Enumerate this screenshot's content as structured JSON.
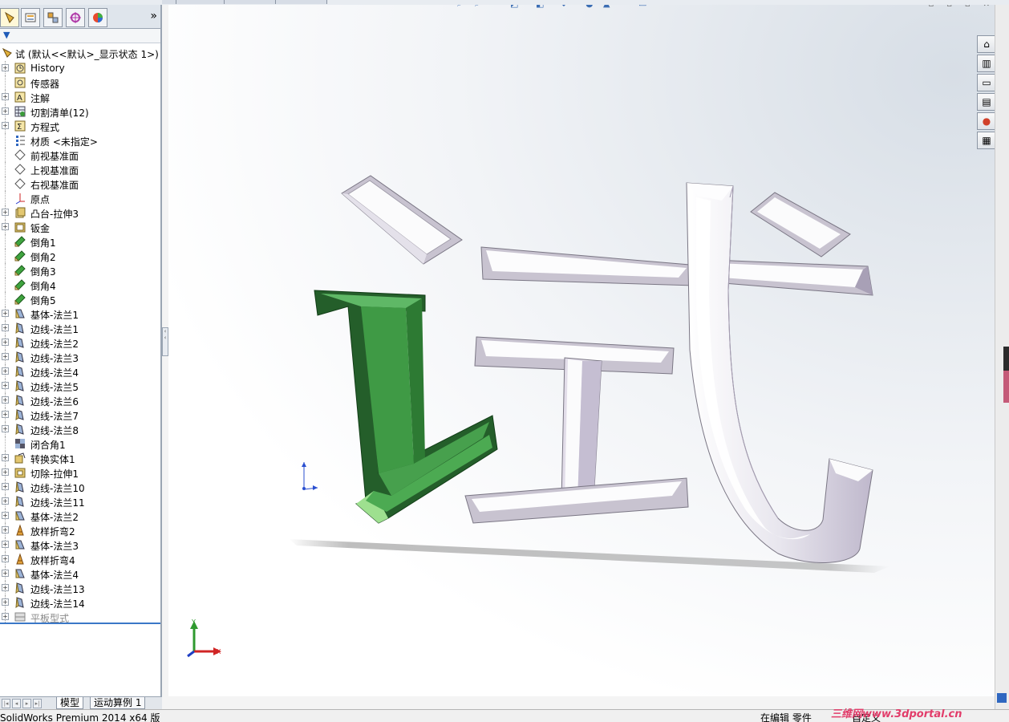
{
  "app": {
    "status_text": "SolidWorks Premium 2014 x64 版",
    "status_editing": "在编辑 零件",
    "status_custom": "自定义",
    "watermark": "三维网www.3dportal.cn"
  },
  "panel": {
    "expand_glyph": "»",
    "root_label": "试 (默认<<默认>_显示状态 1>)",
    "tree": [
      {
        "label": "History",
        "icon": "history-icon",
        "expand": true
      },
      {
        "label": "传感器",
        "icon": "sensor-icon",
        "expand": false
      },
      {
        "label": "注解",
        "icon": "annotation-icon",
        "expand": true
      },
      {
        "label": "切割清单(12)",
        "icon": "cutlist-icon",
        "expand": true
      },
      {
        "label": "方程式",
        "icon": "equation-icon",
        "expand": true
      },
      {
        "label": "材质 <未指定>",
        "icon": "material-icon",
        "expand": false
      },
      {
        "label": "前视基准面",
        "icon": "plane-icon",
        "expand": false
      },
      {
        "label": "上视基准面",
        "icon": "plane-icon",
        "expand": false
      },
      {
        "label": "右视基准面",
        "icon": "plane-icon",
        "expand": false
      },
      {
        "label": "原点",
        "icon": "origin-icon",
        "expand": false
      },
      {
        "label": "凸台-拉伸3",
        "icon": "extrude-icon",
        "expand": true
      },
      {
        "label": "钣金",
        "icon": "sheetmetal-icon",
        "expand": true
      },
      {
        "label": "倒角1",
        "icon": "chamfer-icon",
        "expand": false
      },
      {
        "label": "倒角2",
        "icon": "chamfer-icon",
        "expand": false
      },
      {
        "label": "倒角3",
        "icon": "chamfer-icon",
        "expand": false
      },
      {
        "label": "倒角4",
        "icon": "chamfer-icon",
        "expand": false
      },
      {
        "label": "倒角5",
        "icon": "chamfer-icon",
        "expand": false
      },
      {
        "label": "基体-法兰1",
        "icon": "base-flange-icon",
        "expand": true
      },
      {
        "label": "边线-法兰1",
        "icon": "edge-flange-icon",
        "expand": true
      },
      {
        "label": "边线-法兰2",
        "icon": "edge-flange-icon",
        "expand": true
      },
      {
        "label": "边线-法兰3",
        "icon": "edge-flange-icon",
        "expand": true
      },
      {
        "label": "边线-法兰4",
        "icon": "edge-flange-icon",
        "expand": true
      },
      {
        "label": "边线-法兰5",
        "icon": "edge-flange-icon",
        "expand": true
      },
      {
        "label": "边线-法兰6",
        "icon": "edge-flange-icon",
        "expand": true
      },
      {
        "label": "边线-法兰7",
        "icon": "edge-flange-icon",
        "expand": true
      },
      {
        "label": "边线-法兰8",
        "icon": "edge-flange-icon",
        "expand": true
      },
      {
        "label": "闭合角1",
        "icon": "closed-corner-icon",
        "expand": false
      },
      {
        "label": "转换实体1",
        "icon": "convert-icon",
        "expand": true
      },
      {
        "label": "切除-拉伸1",
        "icon": "cut-extrude-icon",
        "expand": true
      },
      {
        "label": "边线-法兰10",
        "icon": "edge-flange-icon",
        "expand": true
      },
      {
        "label": "边线-法兰11",
        "icon": "edge-flange-icon",
        "expand": true
      },
      {
        "label": "基体-法兰2",
        "icon": "base-flange-icon",
        "expand": true
      },
      {
        "label": "放样折弯2",
        "icon": "lofted-bend-icon",
        "expand": true
      },
      {
        "label": "基体-法兰3",
        "icon": "base-flange-icon",
        "expand": true
      },
      {
        "label": "放样折弯4",
        "icon": "lofted-bend-icon",
        "expand": true
      },
      {
        "label": "基体-法兰4",
        "icon": "base-flange-icon",
        "expand": true
      },
      {
        "label": "边线-法兰13",
        "icon": "edge-flange-icon",
        "expand": true
      },
      {
        "label": "边线-法兰14",
        "icon": "edge-flange-icon",
        "expand": true
      },
      {
        "label": "平板型式",
        "icon": "flat-pattern-icon",
        "expand": true,
        "dim": true
      }
    ]
  },
  "bottom_tabs": [
    {
      "label": "模型",
      "active": true
    },
    {
      "label": "运动算例 1",
      "active": false
    }
  ],
  "triad": {
    "x": "X",
    "y": "Y"
  },
  "colors": {
    "green_face": "#3f9a45",
    "green_dark": "#245e2a",
    "silver_face": "#f7f7f9",
    "silver_side": "#c9c4d3"
  }
}
